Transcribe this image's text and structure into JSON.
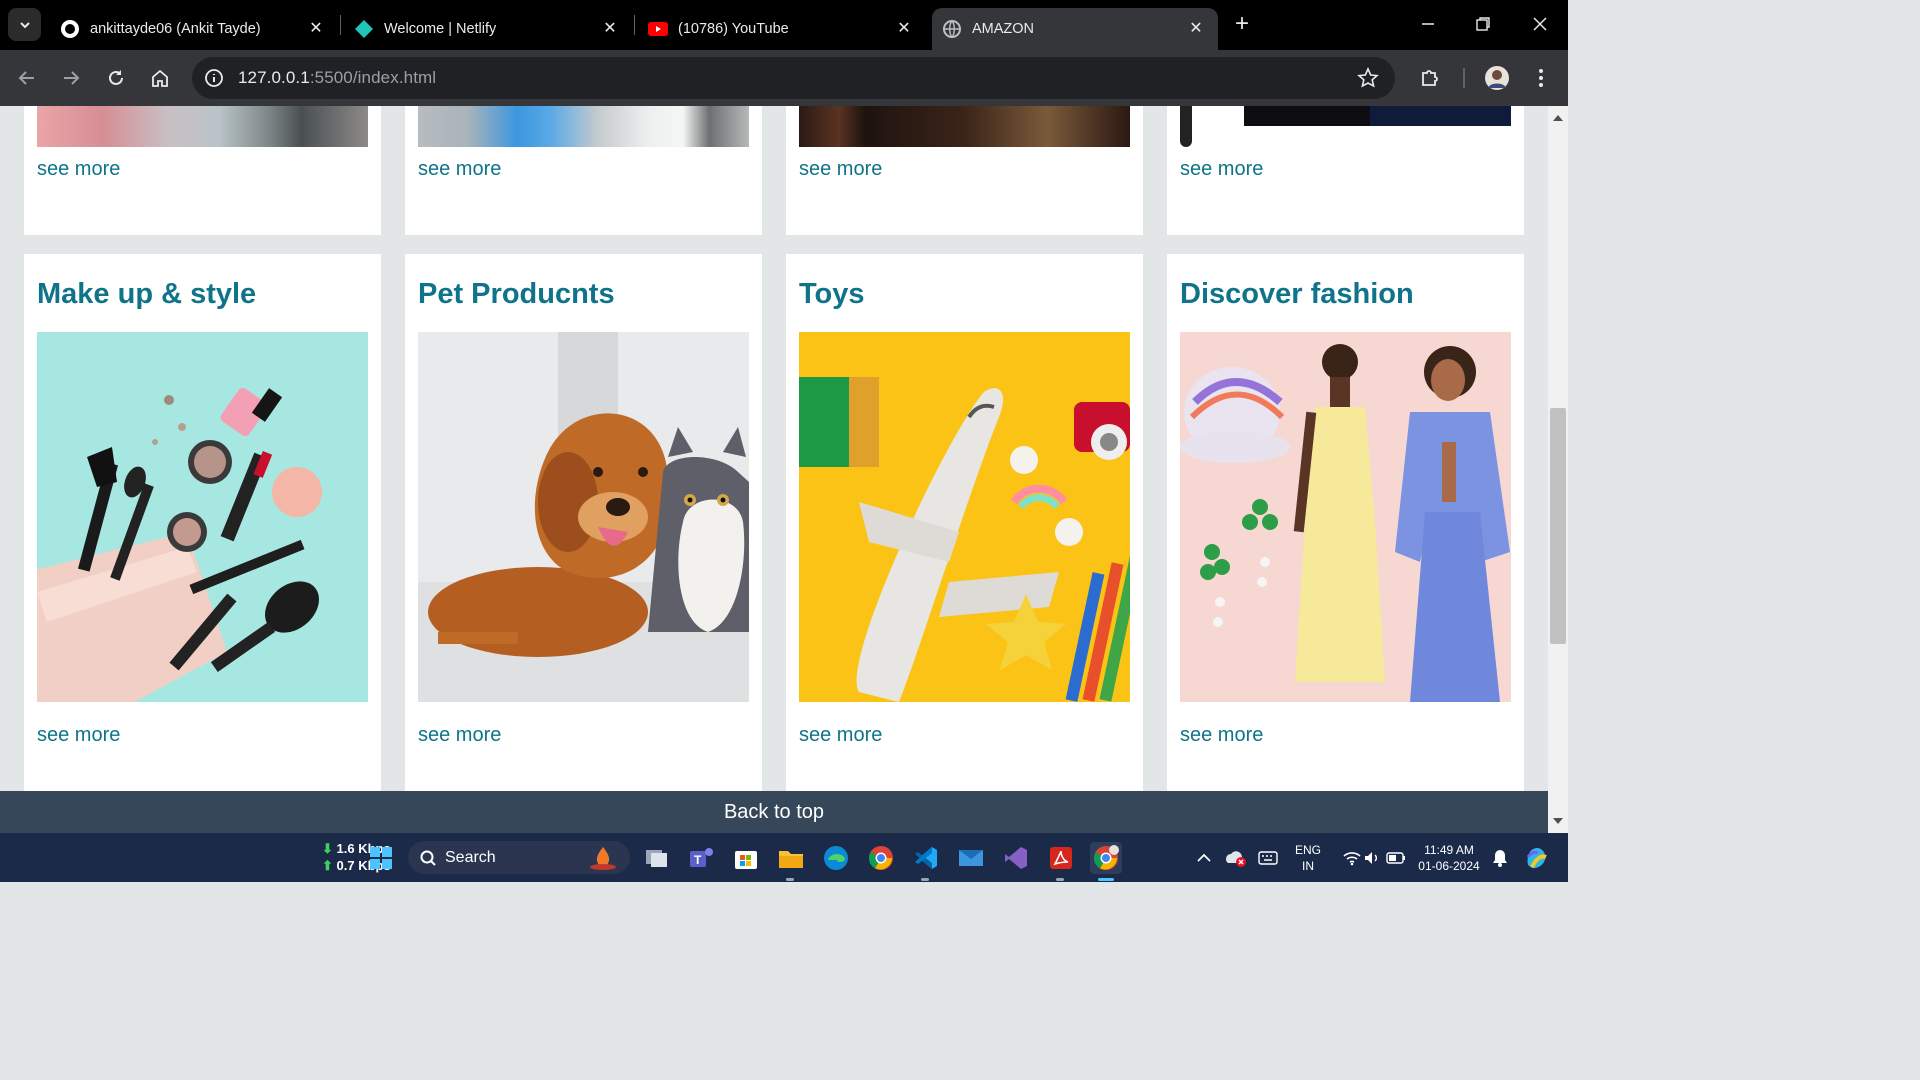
{
  "browser": {
    "tabs": [
      {
        "title": "ankittayde06 (Ankit Tayde)",
        "icon": "github-icon"
      },
      {
        "title": "Welcome | Netlify",
        "icon": "netlify-icon"
      },
      {
        "title": "(10786) YouTube",
        "icon": "youtube-icon"
      },
      {
        "title": "AMAZON",
        "icon": "globe-icon",
        "active": true
      }
    ],
    "url_host": "127.0.0.1",
    "url_path": ":5500/index.html"
  },
  "top_row": {
    "see_more": [
      "see more",
      "see more",
      "see more",
      "see more"
    ]
  },
  "cards": [
    {
      "title": "Make up & style",
      "link": "see more",
      "image": "makeup-image"
    },
    {
      "title": "Pet Producnts",
      "link": "see more",
      "image": "pet-image"
    },
    {
      "title": "Toys",
      "link": "see more",
      "image": "toys-image"
    },
    {
      "title": "Discover fashion",
      "link": "see more",
      "image": "fashion-image"
    }
  ],
  "footer": {
    "back_to_top": "Back to top"
  },
  "taskbar": {
    "net_down": "1.6 Kbps",
    "net_up": "0.7 Kbps",
    "search_label": "Search",
    "lang_line1": "ENG",
    "lang_line2": "IN",
    "time": "11:49 AM",
    "date": "01-06-2024"
  },
  "colors": {
    "accent": "#0f7489",
    "page_bg": "#e3e6e6",
    "footer_bg": "#37475a"
  }
}
